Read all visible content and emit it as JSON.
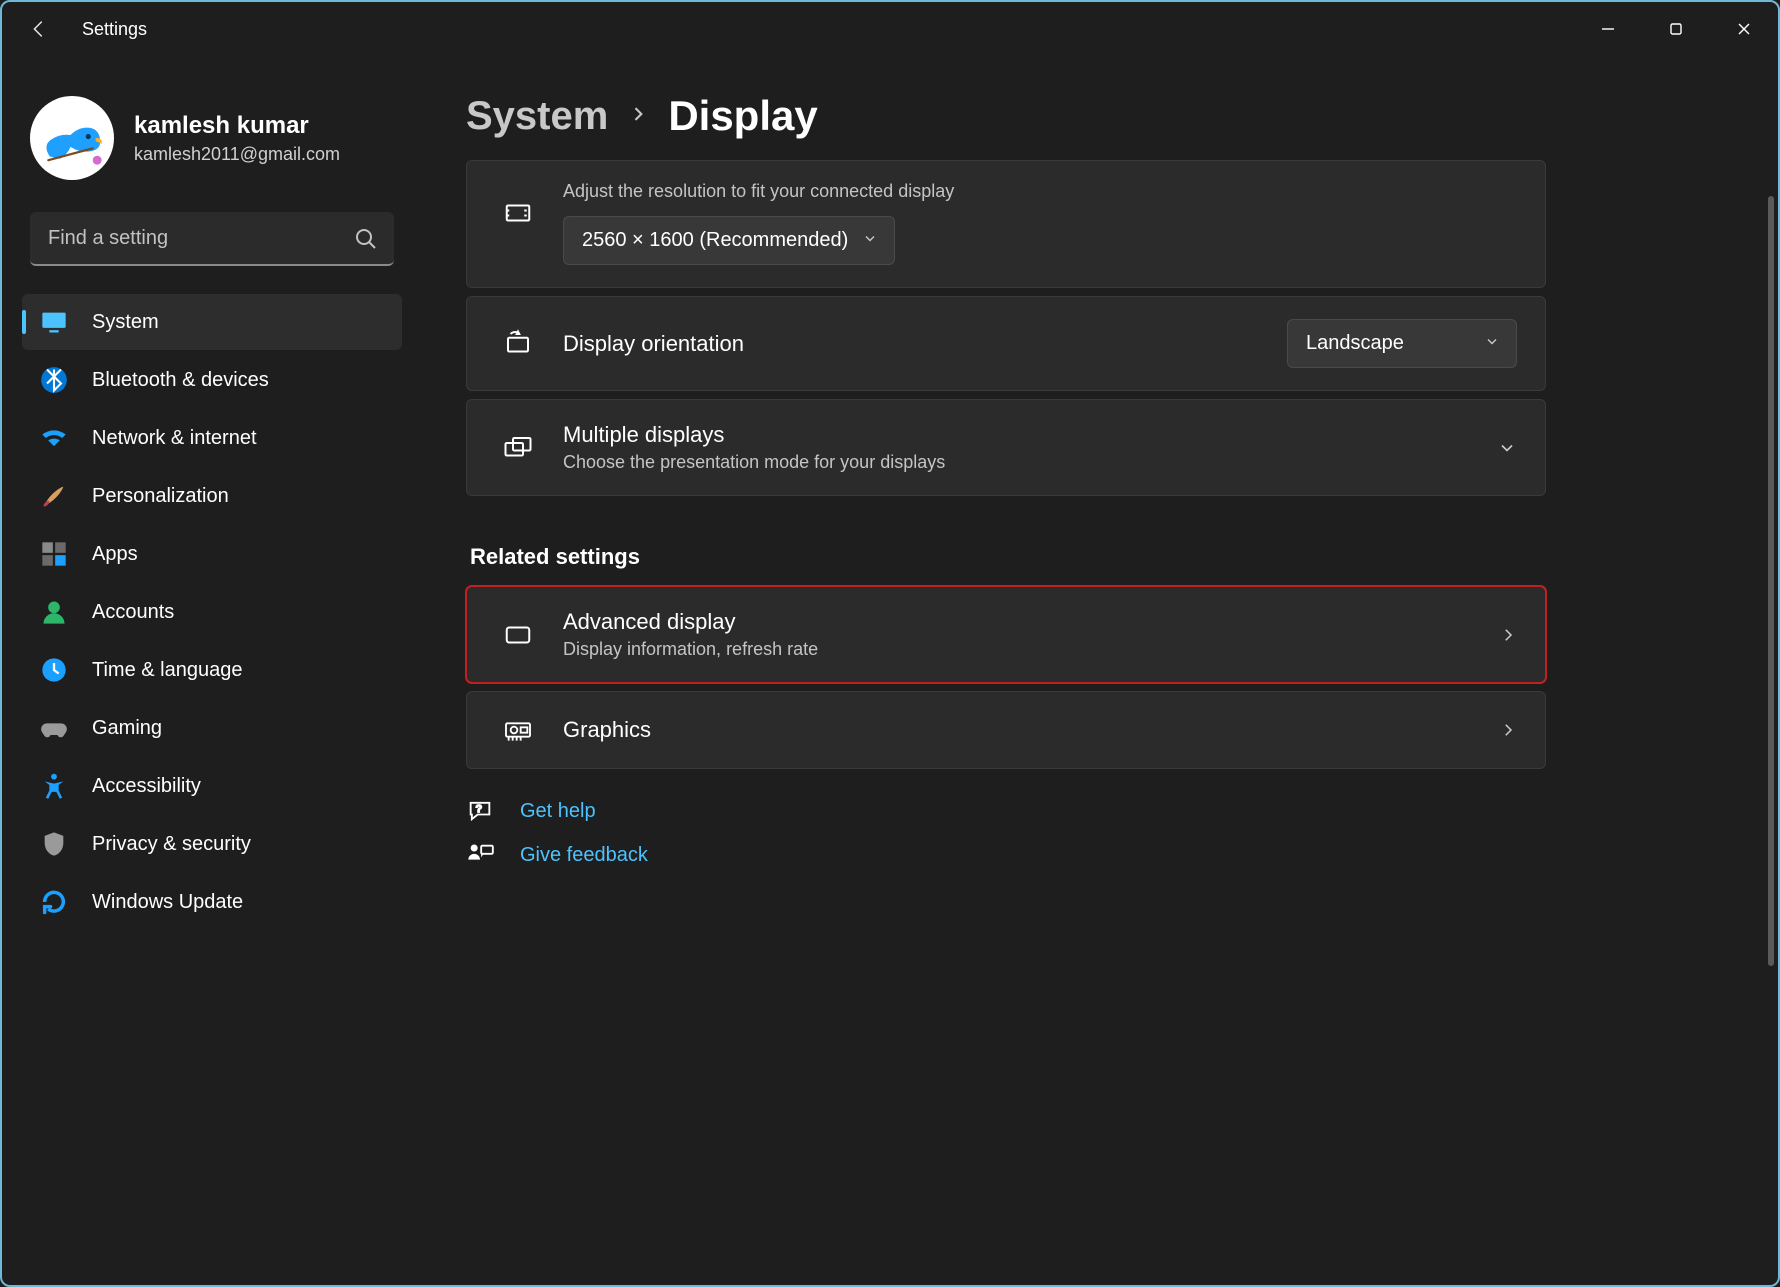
{
  "app_title": "Settings",
  "profile": {
    "name": "kamlesh kumar",
    "email": "kamlesh2011@gmail.com"
  },
  "search": {
    "placeholder": "Find a setting"
  },
  "nav": [
    {
      "label": "System",
      "icon": "monitor",
      "active": true
    },
    {
      "label": "Bluetooth & devices",
      "icon": "bluetooth"
    },
    {
      "label": "Network & internet",
      "icon": "wifi"
    },
    {
      "label": "Personalization",
      "icon": "brush"
    },
    {
      "label": "Apps",
      "icon": "apps"
    },
    {
      "label": "Accounts",
      "icon": "person"
    },
    {
      "label": "Time & language",
      "icon": "clock"
    },
    {
      "label": "Gaming",
      "icon": "gamepad"
    },
    {
      "label": "Accessibility",
      "icon": "accessibility"
    },
    {
      "label": "Privacy & security",
      "icon": "shield"
    },
    {
      "label": "Windows Update",
      "icon": "update"
    }
  ],
  "breadcrumb": {
    "root": "System",
    "current": "Display"
  },
  "cards": {
    "resolution": {
      "desc": "Adjust the resolution to fit your connected display",
      "value": "2560 × 1600 (Recommended)"
    },
    "orientation": {
      "title": "Display orientation",
      "value": "Landscape"
    },
    "multiple": {
      "title": "Multiple displays",
      "sub": "Choose the presentation mode for your displays"
    }
  },
  "related_title": "Related settings",
  "related": {
    "advanced": {
      "title": "Advanced display",
      "sub": "Display information, refresh rate"
    },
    "graphics": {
      "title": "Graphics"
    }
  },
  "links": {
    "help": "Get help",
    "feedback": "Give feedback"
  }
}
